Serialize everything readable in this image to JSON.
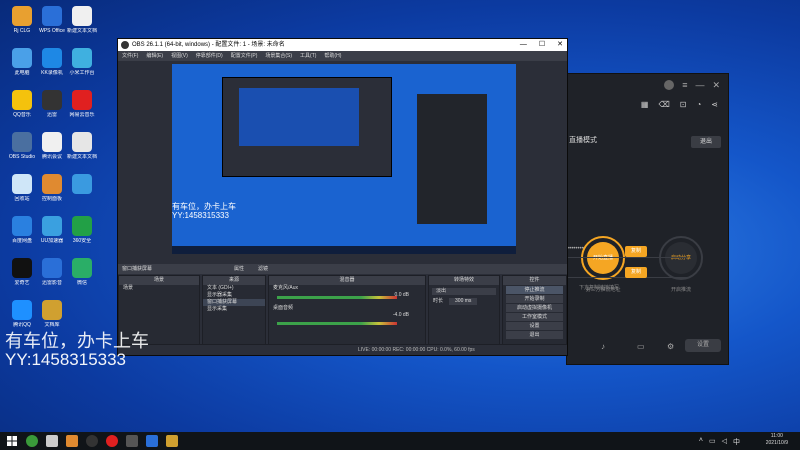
{
  "desktop": {
    "icons": [
      {
        "label": "Rj CLG",
        "color": "#e8a030"
      },
      {
        "label": "WPS Office",
        "color": "#2a6fd8"
      },
      {
        "label": "新建文本文档",
        "color": "#f0f0f0"
      },
      {
        "label": "此电脑",
        "color": "#4aa0e8"
      },
      {
        "label": "KK录像机",
        "color": "#1e88e5"
      },
      {
        "label": "小米工作台",
        "color": "#3fb0e0"
      },
      {
        "label": "QQ音乐",
        "color": "#f4c20d"
      },
      {
        "label": "迅雷",
        "color": "#333333"
      },
      {
        "label": "网易云音乐",
        "color": "#e02020"
      },
      {
        "label": "OBS Studio",
        "color": "#4a6fa0"
      },
      {
        "label": "腾讯会议",
        "color": "#f0f0f0"
      },
      {
        "label": "新建文本文档",
        "color": "#e6e6e6"
      },
      {
        "label": "回收站",
        "color": "#cfe6f8"
      },
      {
        "label": "控制面板",
        "color": "#e08a30"
      },
      {
        "label": "",
        "color": "#3a9ae0"
      },
      {
        "label": "百度网盘",
        "color": "#2a80e0"
      },
      {
        "label": "UU加速器",
        "color": "#3aa0e0"
      },
      {
        "label": "360安全",
        "color": "#22a046"
      },
      {
        "label": "爱奇艺",
        "color": "#111111"
      },
      {
        "label": "迅雷影音",
        "color": "#2a6fd8"
      },
      {
        "label": "微信",
        "color": "#2aae67"
      },
      {
        "label": "腾讯QQ",
        "color": "#1e90ff"
      },
      {
        "label": "文档库",
        "color": "#d0a030"
      }
    ]
  },
  "darkapp": {
    "mode_label": "直播模式",
    "exit_label": "退出",
    "primary_circle": "开始直播",
    "secondary_circle": "启动分享",
    "primary_caption": "第三方推流地址",
    "secondary_caption": "开启推流",
    "field1_value": "••••••••",
    "field2_value": "",
    "ok_label": "复制",
    "hint": "下方复制链接填写",
    "bottom_btn": "设置"
  },
  "obs": {
    "title": "OBS 26.1.1 (64-bit, windows) - 配置文件: 1 - 场景: 未命名",
    "menus": [
      "文件(F)",
      "编辑(E)",
      "视图(V)",
      "停靠部件(D)",
      "配置文件(P)",
      "场景集合(S)",
      "工具(T)",
      "帮助(H)"
    ],
    "selected_source": "窗口捕获屏幕",
    "props_label": "属性",
    "filters_label": "滤镜",
    "scene_header": "场景",
    "scene_items": [
      "场景"
    ],
    "sources_header": "来源",
    "source_items": [
      "文本 (GDI+)",
      "显示器采集",
      "窗口捕获屏幕",
      "显示采集"
    ],
    "mixer_header": "混音器",
    "mixer_items": [
      {
        "name": "麦克风/Aux",
        "db": "0.0 dB"
      },
      {
        "name": "桌面音频",
        "db": "-4.0 dB"
      }
    ],
    "transition_header": "转场特效",
    "transition_value": "淡出",
    "duration_label": "时长",
    "duration_value": "300 ms",
    "controls_header": "控件",
    "controls": [
      "停止推流",
      "开始录制",
      "启动虚拟摄像机",
      "工作室模式",
      "设置",
      "退出"
    ],
    "status": "LIVE: 00:00:00   REC: 00:00:00   CPU: 0.0%, 60.00 fps"
  },
  "watermark": {
    "line1": "有车位，办卡上车",
    "line2": "YY:1458315333",
    "preview_line1": "有车位，办卡上车",
    "preview_line2": "YY:1458315333"
  },
  "taskbar": {
    "time": "11:00",
    "date": "2021/10/9"
  }
}
